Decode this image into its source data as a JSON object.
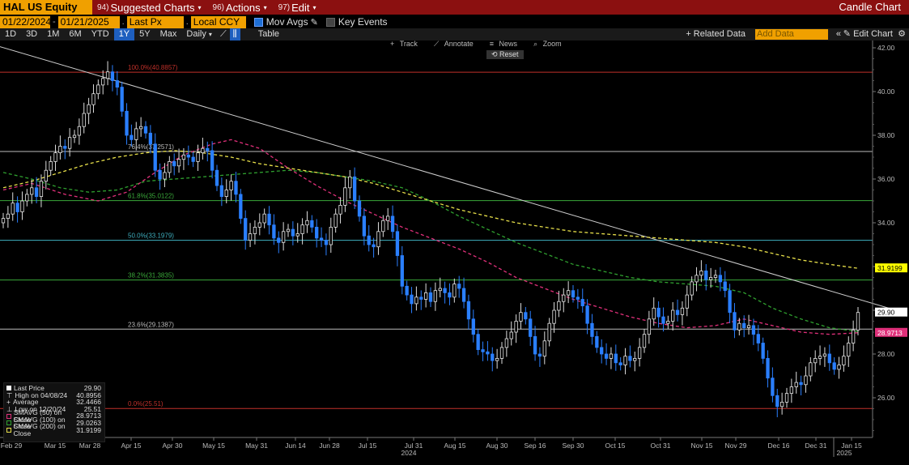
{
  "header": {
    "ticker": "HAL US Equity",
    "menus": [
      {
        "num": "94)",
        "label": "Suggested Charts"
      },
      {
        "num": "96)",
        "label": "Actions"
      },
      {
        "num": "97)",
        "label": "Edit"
      }
    ],
    "window_title": "Candle Chart"
  },
  "controls": {
    "start_date": "01/22/2024",
    "end_date": "01/21/2025",
    "field": "Last Px",
    "currency": "Local CCY",
    "mov_avgs": "Mov Avgs",
    "key_events": "Key Events"
  },
  "toolbar": {
    "periods": [
      "1D",
      "3D",
      "1M",
      "6M",
      "YTD",
      "1Y",
      "5Y",
      "Max"
    ],
    "selected_period": "1Y",
    "frequency": "Daily",
    "table": "Table",
    "related": "+ Related Data",
    "add_data_placeholder": "Add Data",
    "edit_chart": "Edit Chart"
  },
  "chart_tools": {
    "track": "Track",
    "annotate": "Annotate",
    "news": "News",
    "zoom": "Zoom",
    "reset": "Reset"
  },
  "legend": {
    "rows": [
      {
        "label": "Last Price",
        "value": "29.90",
        "color": "#ffffff"
      },
      {
        "label": "High on 04/08/24",
        "value": "40.8956",
        "color": ""
      },
      {
        "label": "Average",
        "value": "32.4466",
        "color": ""
      },
      {
        "label": "Low on 12/20/24",
        "value": "25.51",
        "color": ""
      },
      {
        "label": "SMAVG (50)  on Close",
        "value": "28.9713",
        "color": "#e0307a"
      },
      {
        "label": "SMAVG (100)  on Close",
        "value": "29.0263",
        "color": "#2fa02f"
      },
      {
        "label": "SMAVG (200)  on Close",
        "value": "31.9199",
        "color": "#e8e04a"
      }
    ]
  },
  "chart_data": {
    "type": "candlestick",
    "ylim": [
      24.0,
      42.0
    ],
    "y_ticks": [
      26.0,
      28.0,
      30.0,
      32.0,
      34.0,
      36.0,
      38.0,
      40.0,
      42.0
    ],
    "y_tick_labels": [
      "26.00",
      "28.00",
      "30.00",
      "32.00",
      "34.00",
      "36.00",
      "38.00",
      "40.00",
      "42.00"
    ],
    "x_tick_labels": [
      "Feb 29",
      "Mar 15",
      "Mar 28",
      "Apr 15",
      "Apr 30",
      "May 15",
      "May 31",
      "Jun 14",
      "Jun 28",
      "Jul 15",
      "Jul 31",
      "Aug 15",
      "Aug 30",
      "Sep 16",
      "Sep 30",
      "Oct 15",
      "Oct 31",
      "Nov 15",
      "Nov 29",
      "Dec 16",
      "Dec 31",
      "Jan 15"
    ],
    "year_labels": [
      "2024",
      "2025"
    ],
    "fib_levels": [
      {
        "label": "100.0%(40.8857)",
        "value": 40.8857,
        "color": "#c0302a"
      },
      {
        "label": "76.4%(37.2571)",
        "value": 37.2571,
        "color": "#bbbbbb"
      },
      {
        "label": "61.8%(35.0122)",
        "value": 35.0122,
        "color": "#3aa83a"
      },
      {
        "label": "50.0%(33.1979)",
        "value": 33.1979,
        "color": "#3fb0c0"
      },
      {
        "label": "38.2%(31.3835)",
        "value": 31.3835,
        "color": "#3aa83a"
      },
      {
        "label": "23.6%(29.1387)",
        "value": 29.1387,
        "color": "#bbbbbb"
      },
      {
        "label": "0.0%(25.51)",
        "value": 25.51,
        "color": "#c0302a"
      }
    ],
    "price_tags": [
      {
        "value": 31.9199,
        "label": "31.9199",
        "color": "#ffff00",
        "text_color": "#000000"
      },
      {
        "value": 29.9,
        "label": "29.90",
        "color": "#ffffff",
        "text_color": "#000000"
      },
      {
        "value": 28.9713,
        "label": "28.9713",
        "color": "#e0307a",
        "text_color": "#ffffff"
      }
    ],
    "closes": [
      34.2,
      34.4,
      34.9,
      34.5,
      35.0,
      35.3,
      35.6,
      35.2,
      35.9,
      36.4,
      36.8,
      37.2,
      37.5,
      37.4,
      37.9,
      38.0,
      38.4,
      39.0,
      39.4,
      39.9,
      40.3,
      40.6,
      40.9,
      40.5,
      40.2,
      39.1,
      38.0,
      37.8,
      38.3,
      38.4,
      38.1,
      37.6,
      36.4,
      36.0,
      36.3,
      36.8,
      36.6,
      36.9,
      37.1,
      37.0,
      36.8,
      37.2,
      37.4,
      37.3,
      36.4,
      35.7,
      35.2,
      35.5,
      35.9,
      35.3,
      34.2,
      33.2,
      33.5,
      33.8,
      34.0,
      34.4,
      33.9,
      33.3,
      33.1,
      33.6,
      33.7,
      33.4,
      33.5,
      33.9,
      34.1,
      33.8,
      33.3,
      33.2,
      33.0,
      33.8,
      34.4,
      34.8,
      35.6,
      36.1,
      35.0,
      34.3,
      33.4,
      33.0,
      32.9,
      33.6,
      34.1,
      34.3,
      33.6,
      32.5,
      31.1,
      30.7,
      30.3,
      30.6,
      30.5,
      30.8,
      30.4,
      30.9,
      31.0,
      30.8,
      30.6,
      31.2,
      31.0,
      30.4,
      29.6,
      28.9,
      28.2,
      28.1,
      28.0,
      27.7,
      27.8,
      28.3,
      28.7,
      29.0,
      29.5,
      29.9,
      29.6,
      28.8,
      28.0,
      27.9,
      28.6,
      29.4,
      30.0,
      30.4,
      30.7,
      30.9,
      30.6,
      30.5,
      30.2,
      29.4,
      28.8,
      28.3,
      28.0,
      27.8,
      28.0,
      27.6,
      27.5,
      27.9,
      27.7,
      27.8,
      28.3,
      28.9,
      29.6,
      30.1,
      29.7,
      29.4,
      29.5,
      30.0,
      29.8,
      30.1,
      30.7,
      31.3,
      31.6,
      31.8,
      31.4,
      31.5,
      31.6,
      31.3,
      30.9,
      29.9,
      29.1,
      29.4,
      29.2,
      29.3,
      28.9,
      28.5,
      27.8,
      26.9,
      26.1,
      25.6,
      25.8,
      26.2,
      26.5,
      26.7,
      26.6,
      27.0,
      27.6,
      27.8,
      27.9,
      28.0,
      27.6,
      27.3,
      27.5,
      27.9,
      28.5,
      29.1,
      29.9
    ],
    "sma50": [
      [
        0,
        35.5
      ],
      [
        6,
        35.8
      ],
      [
        13,
        35.3
      ],
      [
        20,
        35.0
      ],
      [
        26,
        35.4
      ],
      [
        32,
        36.3
      ],
      [
        38,
        37.1
      ],
      [
        44,
        37.6
      ],
      [
        48,
        37.8
      ],
      [
        54,
        37.4
      ],
      [
        60,
        36.5
      ],
      [
        66,
        35.7
      ],
      [
        72,
        35.0
      ],
      [
        78,
        34.4
      ],
      [
        84,
        33.8
      ],
      [
        90,
        33.3
      ],
      [
        96,
        32.8
      ],
      [
        102,
        32.2
      ],
      [
        108,
        31.5
      ],
      [
        114,
        31.0
      ],
      [
        120,
        30.5
      ],
      [
        126,
        30.1
      ],
      [
        132,
        29.7
      ],
      [
        138,
        29.4
      ],
      [
        144,
        29.2
      ],
      [
        150,
        29.3
      ],
      [
        156,
        29.6
      ],
      [
        162,
        29.3
      ],
      [
        168,
        29.0
      ],
      [
        174,
        28.9
      ],
      [
        180,
        28.97
      ]
    ],
    "sma100": [
      [
        0,
        36.3
      ],
      [
        6,
        36.0
      ],
      [
        12,
        35.6
      ],
      [
        18,
        35.4
      ],
      [
        24,
        35.5
      ],
      [
        30,
        35.9
      ],
      [
        36,
        36.0
      ],
      [
        42,
        36.1
      ],
      [
        48,
        36.2
      ],
      [
        54,
        36.3
      ],
      [
        60,
        36.4
      ],
      [
        66,
        36.3
      ],
      [
        72,
        36.1
      ],
      [
        78,
        35.9
      ],
      [
        84,
        35.6
      ],
      [
        90,
        35.0
      ],
      [
        96,
        34.3
      ],
      [
        102,
        33.7
      ],
      [
        108,
        33.1
      ],
      [
        114,
        32.6
      ],
      [
        120,
        32.1
      ],
      [
        126,
        31.8
      ],
      [
        132,
        31.5
      ],
      [
        138,
        31.3
      ],
      [
        144,
        31.2
      ],
      [
        150,
        31.1
      ],
      [
        156,
        30.8
      ],
      [
        162,
        30.1
      ],
      [
        168,
        29.6
      ],
      [
        174,
        29.2
      ],
      [
        180,
        29.03
      ]
    ],
    "sma200": [
      [
        0,
        35.6
      ],
      [
        6,
        35.9
      ],
      [
        12,
        36.3
      ],
      [
        18,
        36.7
      ],
      [
        24,
        37.0
      ],
      [
        30,
        37.2
      ],
      [
        36,
        37.3
      ],
      [
        42,
        37.2
      ],
      [
        48,
        37.0
      ],
      [
        54,
        36.7
      ],
      [
        60,
        36.5
      ],
      [
        66,
        36.3
      ],
      [
        72,
        36.1
      ],
      [
        78,
        35.8
      ],
      [
        84,
        35.4
      ],
      [
        90,
        35.0
      ],
      [
        96,
        34.6
      ],
      [
        102,
        34.3
      ],
      [
        108,
        34.0
      ],
      [
        114,
        33.8
      ],
      [
        120,
        33.6
      ],
      [
        126,
        33.5
      ],
      [
        132,
        33.4
      ],
      [
        138,
        33.3
      ],
      [
        144,
        33.2
      ],
      [
        150,
        33.1
      ],
      [
        156,
        32.9
      ],
      [
        162,
        32.6
      ],
      [
        168,
        32.3
      ],
      [
        174,
        32.1
      ],
      [
        180,
        31.92
      ]
    ],
    "trendline": [
      [
        -3,
        42.2
      ],
      [
        188,
        30.0
      ]
    ]
  }
}
